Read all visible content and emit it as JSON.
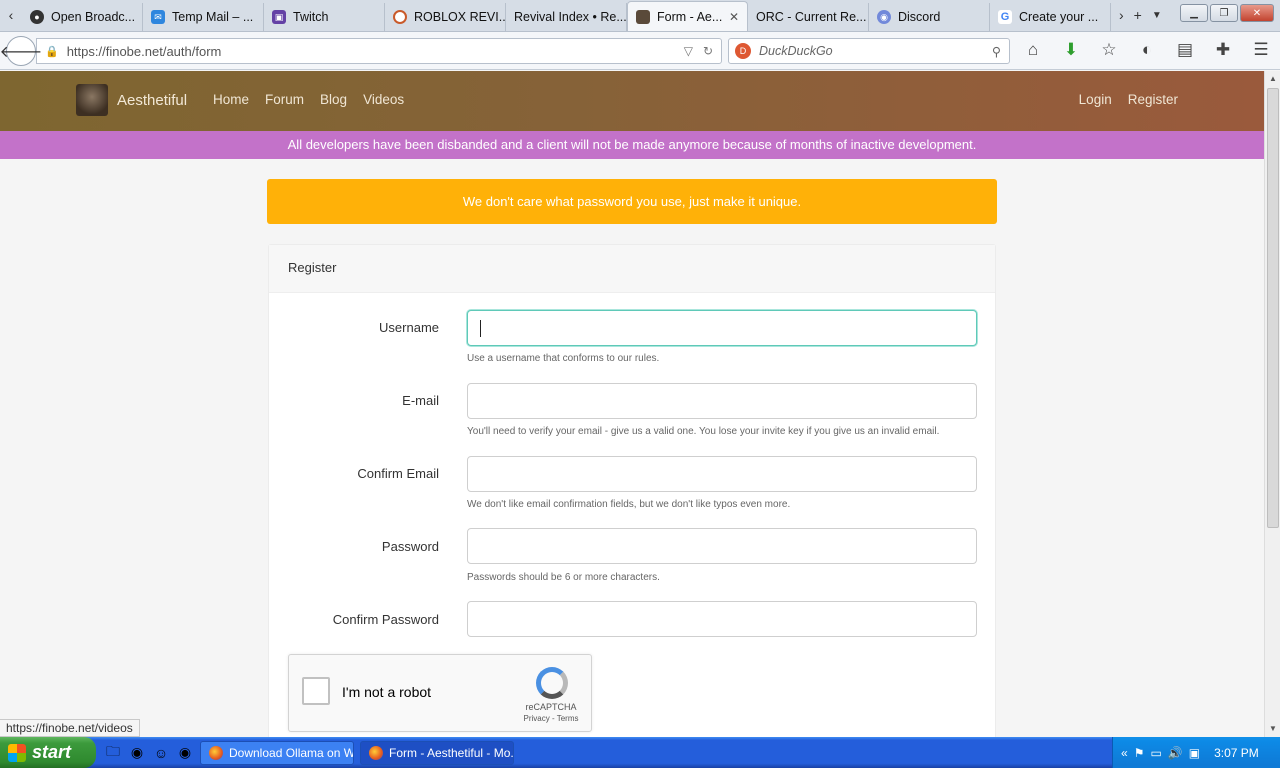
{
  "browser": {
    "tabs": [
      {
        "label": "Open Broadc...",
        "icon": "obs-icon",
        "active": false
      },
      {
        "label": "Temp Mail – ...",
        "icon": "tempmail-icon",
        "active": false
      },
      {
        "label": "Twitch",
        "icon": "twitch-icon",
        "active": false
      },
      {
        "label": "ROBLOX REVI...",
        "icon": "roblox-icon",
        "active": false
      },
      {
        "label": "Revival Index • Re...",
        "icon": "",
        "active": false
      },
      {
        "label": "Form - Ae...",
        "icon": "site-icon",
        "active": true
      },
      {
        "label": "ORC - Current Re...",
        "icon": "",
        "active": false
      },
      {
        "label": "Discord",
        "icon": "discord-icon",
        "active": false
      },
      {
        "label": "Create your ...",
        "icon": "google-icon",
        "active": false
      }
    ],
    "url": "https://finobe.net/auth/form",
    "search_placeholder": "DuckDuckGo",
    "status_url": "https://finobe.net/videos"
  },
  "site": {
    "brand": "Aesthetiful",
    "nav": [
      "Home",
      "Forum",
      "Blog",
      "Videos"
    ],
    "auth": {
      "login": "Login",
      "register": "Register"
    },
    "announcement": "All developers have been disbanded and a client will not be made anymore because of months of inactive development.",
    "alert": "We don't care what password you use, just make it unique."
  },
  "form": {
    "title": "Register",
    "fields": [
      {
        "label": "Username",
        "value": "",
        "help": "Use a username that conforms to our rules."
      },
      {
        "label": "E-mail",
        "value": "",
        "help": "You'll need to verify your email - give us a valid one. You lose your invite key if you give us an invalid email."
      },
      {
        "label": "Confirm Email",
        "value": "",
        "help": "We don't like email confirmation fields, but we don't like typos even more."
      },
      {
        "label": "Password",
        "value": "",
        "help": "Passwords should be 6 or more characters."
      },
      {
        "label": "Confirm Password",
        "value": "",
        "help": ""
      }
    ],
    "captcha": {
      "label": "I'm not a robot",
      "brand": "reCAPTCHA",
      "links": "Privacy - Terms"
    }
  },
  "taskbar": {
    "start": "start",
    "tasks": [
      {
        "label": "Download Ollama on W...",
        "active": false
      },
      {
        "label": "Form - Aesthetiful - Mo...",
        "active": true
      }
    ],
    "clock": "3:07 PM"
  },
  "colors": {
    "nav_gradient_start": "#7e6630",
    "nav_gradient_end": "#9a5a3c",
    "announce": "#c372c9",
    "alert": "#ffb108",
    "focus": "#5fc9b8"
  }
}
